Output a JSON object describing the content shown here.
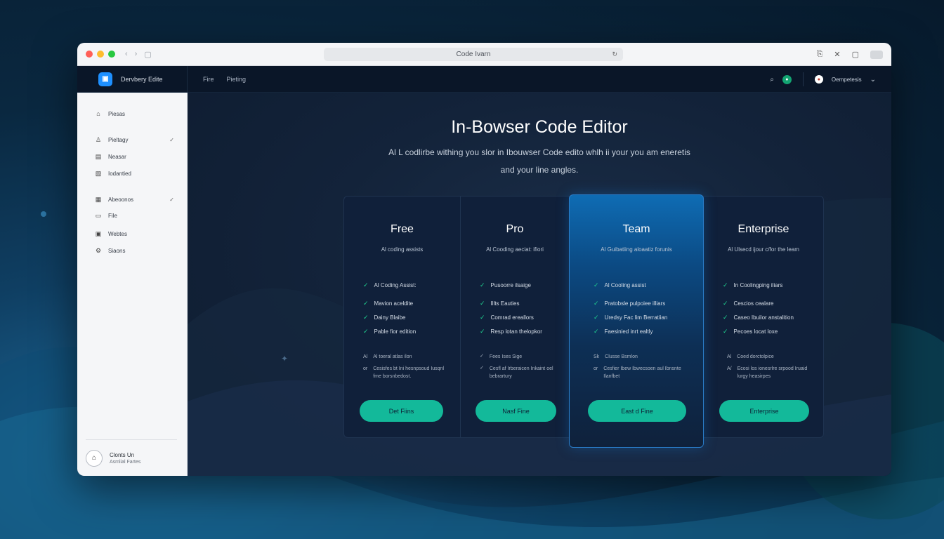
{
  "browser": {
    "url": "Code Ivarn",
    "back_label": "‹",
    "forward_label": "›"
  },
  "app": {
    "brand_name": "Dervbery Edite",
    "topnav": [
      "Fire",
      "Pieting"
    ],
    "user_name": "Oempetesis"
  },
  "sidebar": {
    "groups": [
      [
        {
          "label": "Piesas",
          "icon": "home-icon",
          "check": ""
        }
      ],
      [
        {
          "label": "Pieltagy",
          "icon": "user-icon",
          "check": "✓"
        },
        {
          "label": "Neasar",
          "icon": "document-icon",
          "check": ""
        },
        {
          "label": "Iodantied",
          "icon": "image-icon",
          "check": ""
        }
      ],
      [
        {
          "label": "Abeoonos",
          "icon": "calendar-icon",
          "check": "✓"
        },
        {
          "label": "File",
          "icon": "file-icon",
          "check": ""
        },
        {
          "label": "Webtes",
          "icon": "folder-icon",
          "check": ""
        },
        {
          "label": "Siaons",
          "icon": "settings-icon",
          "check": ""
        }
      ]
    ],
    "footer": {
      "name": "Clonts Un",
      "sub": "Asmlial Fartes"
    }
  },
  "hero": {
    "title": "In-Bowser Code Editor",
    "subtitle_line1": "Al L codlirbe withing you slor in Ibouwser Code edito whlh ii your you am eneretis",
    "subtitle_line2": "and your line angles."
  },
  "plans": [
    {
      "name": "Free",
      "desc": "Al coding assists",
      "features": [
        "Al Coding Assist:",
        "Mavion aceldite",
        "Dainy Blaibe",
        "Pable fior edition"
      ],
      "extras": [
        {
          "mark": "Al",
          "text": "Al toeral atlas ilon"
        },
        {
          "mark": "or",
          "text": "Cesisfes bt Ini hesnpsoud Iusqnl fme borsnbedost."
        }
      ],
      "cta": "Det Fiins"
    },
    {
      "name": "Pro",
      "desc": "Al Cooding aeciat: ifiori",
      "features": [
        "Pusoorre ilsaige",
        "Illts Eauties",
        "Comrad ereallors",
        "Resp lotan thelopkor"
      ],
      "extras": [
        {
          "mark": "✓",
          "text": "Fees Ises Sige"
        },
        {
          "mark": "✓",
          "text": "Cesfl af Irberaicen Inkaint oel bebrartury"
        }
      ],
      "cta": "Nasf Fine"
    },
    {
      "name": "Team",
      "desc": "Al Guibatiing aloaatiz forunis",
      "features": [
        "Al Cooling assist",
        "Pratobsle pulpoiee illiars",
        "Uredsy Fac lim Berratiian",
        "Faesinied inrt ealtly"
      ],
      "extras": [
        {
          "mark": "Sk",
          "text": "Clusse Bsmlon"
        },
        {
          "mark": "or",
          "text": "Cesfier Ibew Ibwecsoen aul Ibnsnte Ilanfbet"
        }
      ],
      "cta": "East d Fine"
    },
    {
      "name": "Enterprise",
      "desc": "Al Ulsecd ijour c/for the leam",
      "features": [
        "In Coolingping iliars",
        "Cescios cealare",
        "Caseo Ibuilor anstalition",
        "Pecoes locat loxe"
      ],
      "extras": [
        {
          "mark": "Al",
          "text": "Coed dorctolpice"
        },
        {
          "mark": "A/",
          "text": "Ecosi los ionesrlre srpood Iruaid lurgy heasirpes"
        }
      ],
      "cta": "Enterprise"
    }
  ],
  "colors": {
    "accent": "#13b99a",
    "highlight": "#0e6cb4",
    "check": "#1fd08e",
    "brand": "#1e90ff"
  }
}
